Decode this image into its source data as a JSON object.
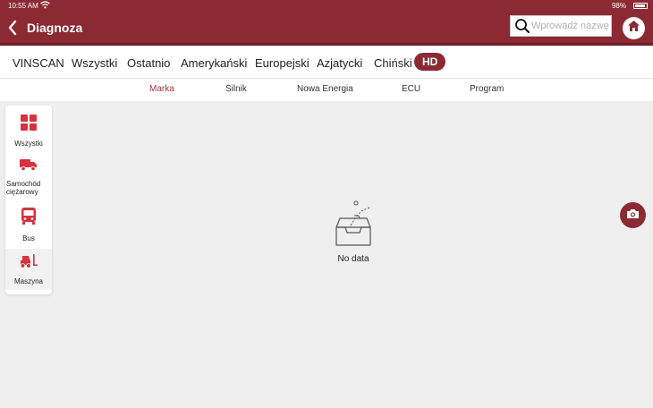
{
  "status_bar": {
    "time": "10:55 AM",
    "battery": "98%"
  },
  "header": {
    "title": "Diagnoza",
    "search_placeholder": "Wprowadź nazwę"
  },
  "categories": [
    {
      "label": "VINSCAN"
    },
    {
      "label": "Wszystki"
    },
    {
      "label": "Ostatnio"
    },
    {
      "label": "Amerykański"
    },
    {
      "label": "Europejski"
    },
    {
      "label": "Azjatycki"
    },
    {
      "label": "Chiński"
    },
    {
      "label": "HD"
    }
  ],
  "active_category": "HD",
  "sub_tabs": [
    {
      "label": "Marka"
    },
    {
      "label": "Silnik"
    },
    {
      "label": "Nowa Energia"
    },
    {
      "label": "ECU"
    },
    {
      "label": "Program"
    }
  ],
  "active_sub_tab": "Marka",
  "sidebar": [
    {
      "label": "Wszystki",
      "icon": "grid-icon"
    },
    {
      "label": "Samochód ciężarowy",
      "icon": "truck-icon"
    },
    {
      "label": "Bus",
      "icon": "bus-icon"
    },
    {
      "label": "Maszyna",
      "icon": "forklift-icon"
    }
  ],
  "selected_sidebar": "Maszyna",
  "empty_state": {
    "text": "No data",
    "icon": "empty-box-icon"
  },
  "colors": {
    "brand": "#8b2a33",
    "icon_red": "#d6323f",
    "active_subtab": "#a13440",
    "background": "#efefef"
  }
}
